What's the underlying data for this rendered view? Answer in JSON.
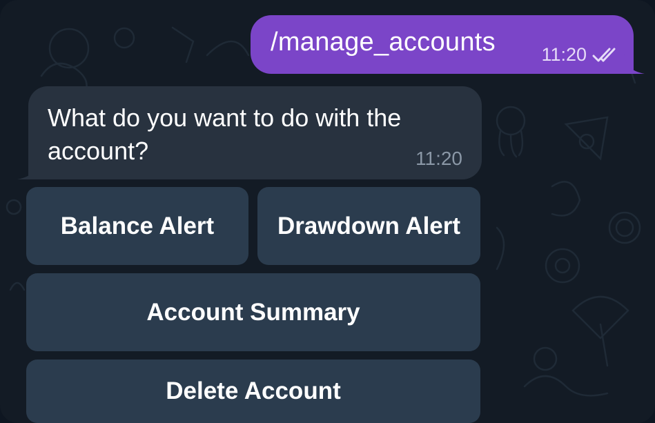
{
  "outgoing_message": {
    "text": "/manage_accounts",
    "time": "11:20",
    "status_icon": "double-check-icon"
  },
  "incoming_message": {
    "text": "What do you want to do with the account?",
    "time": "11:20"
  },
  "inline_keyboard": {
    "balance_alert": "Balance Alert",
    "drawdown_alert": "Drawdown Alert",
    "account_summary": "Account Summary",
    "delete_account": "Delete Account"
  },
  "colors": {
    "background": "#131b25",
    "outgoing_bubble": "#7b45c8",
    "incoming_bubble": "#28323f",
    "keyboard_button": "#2b3c4e"
  }
}
